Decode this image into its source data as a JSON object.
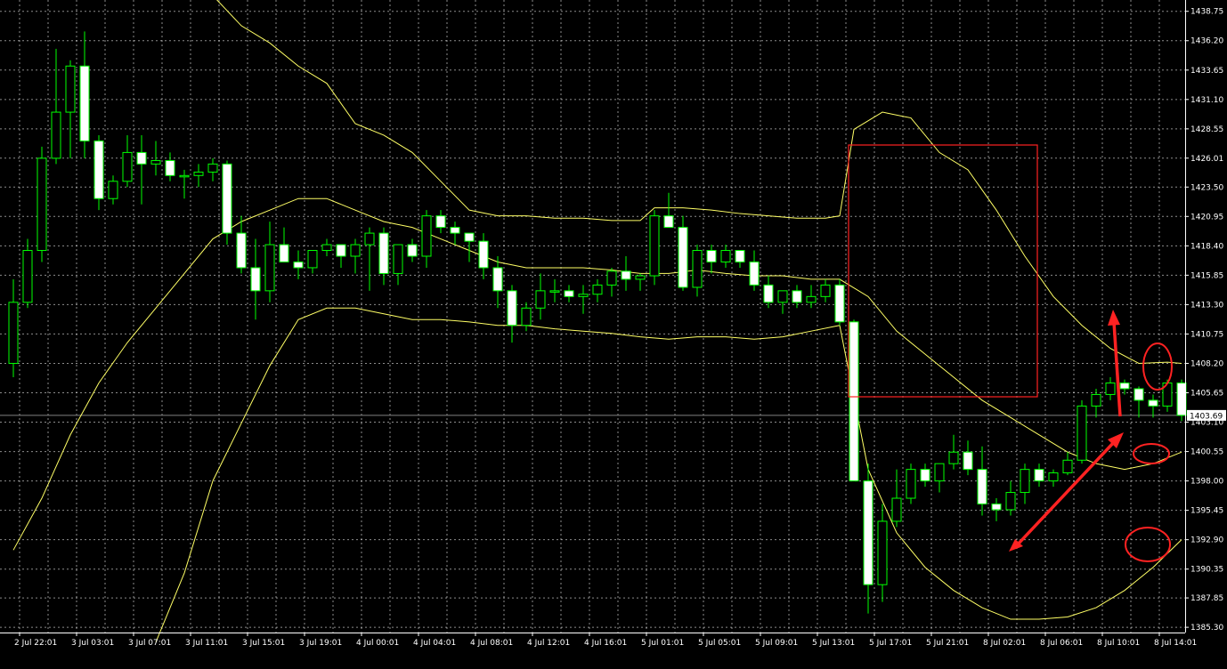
{
  "colors": {
    "background": "#000000",
    "grid": "#ffffff",
    "candle_up": "#000000",
    "candle_down": "#ffffff",
    "wick": "#00ff00",
    "bands": "#ffff66",
    "annotation": "#ff2222",
    "price_line": "#808080",
    "axis_text": "#ffffff"
  },
  "chart_data": {
    "type": "candlestick",
    "title": "",
    "xlabel": "",
    "ylabel": "",
    "ylim": [
      1385.0,
      1439.5
    ],
    "grid": true,
    "y_ticks": [
      "1438.75",
      "1436.20",
      "1433.65",
      "1431.10",
      "1428.55",
      "1426.01",
      "1423.50",
      "1420.95",
      "1418.40",
      "1415.85",
      "1413.30",
      "1410.75",
      "1408.20",
      "1405.65",
      "1403.10",
      "1400.55",
      "1398.00",
      "1395.45",
      "1392.90",
      "1390.35",
      "1387.85",
      "1385.30"
    ],
    "x_labels": [
      "2 Jul 22:01",
      "3 Jul 03:01",
      "3 Jul 07:01",
      "3 Jul 11:01",
      "3 Jul 15:01",
      "3 Jul 19:01",
      "4 Jul 00:01",
      "4 Jul 04:01",
      "4 Jul 08:01",
      "4 Jul 12:01",
      "4 Jul 16:01",
      "5 Jul 01:01",
      "5 Jul 05:01",
      "5 Jul 09:01",
      "5 Jul 13:01",
      "5 Jul 17:01",
      "5 Jul 21:01",
      "8 Jul 02:01",
      "8 Jul 06:01",
      "8 Jul 10:01",
      "8 Jul 14:01"
    ],
    "current_price": "1403.69",
    "candles": [
      {
        "o": 1408.2,
        "h": 1415.5,
        "l": 1407.0,
        "c": 1413.5
      },
      {
        "o": 1413.5,
        "h": 1419.0,
        "l": 1413.0,
        "c": 1418.0
      },
      {
        "o": 1418.0,
        "h": 1427.0,
        "l": 1417.0,
        "c": 1426.0
      },
      {
        "o": 1426.0,
        "h": 1435.5,
        "l": 1425.5,
        "c": 1430.0
      },
      {
        "o": 1430.0,
        "h": 1434.5,
        "l": 1426.0,
        "c": 1434.0
      },
      {
        "o": 1434.0,
        "h": 1437.0,
        "l": 1426.0,
        "c": 1427.5
      },
      {
        "o": 1427.5,
        "h": 1428.0,
        "l": 1421.5,
        "c": 1422.5
      },
      {
        "o": 1422.5,
        "h": 1424.5,
        "l": 1422.0,
        "c": 1424.0
      },
      {
        "o": 1424.0,
        "h": 1428.0,
        "l": 1423.5,
        "c": 1426.5
      },
      {
        "o": 1426.5,
        "h": 1428.0,
        "l": 1422.0,
        "c": 1425.5
      },
      {
        "o": 1425.5,
        "h": 1427.5,
        "l": 1424.5,
        "c": 1425.8
      },
      {
        "o": 1425.8,
        "h": 1426.5,
        "l": 1424.0,
        "c": 1424.5
      },
      {
        "o": 1424.5,
        "h": 1425.0,
        "l": 1422.5,
        "c": 1424.5
      },
      {
        "o": 1424.5,
        "h": 1425.5,
        "l": 1423.5,
        "c": 1424.8
      },
      {
        "o": 1424.8,
        "h": 1426.0,
        "l": 1424.0,
        "c": 1425.5
      },
      {
        "o": 1425.5,
        "h": 1425.8,
        "l": 1418.5,
        "c": 1419.5
      },
      {
        "o": 1419.5,
        "h": 1421.0,
        "l": 1416.0,
        "c": 1416.5
      },
      {
        "o": 1416.5,
        "h": 1419.0,
        "l": 1412.0,
        "c": 1414.5
      },
      {
        "o": 1414.5,
        "h": 1420.5,
        "l": 1413.5,
        "c": 1418.5
      },
      {
        "o": 1418.5,
        "h": 1420.0,
        "l": 1417.0,
        "c": 1417.0
      },
      {
        "o": 1417.0,
        "h": 1418.0,
        "l": 1415.5,
        "c": 1416.5
      },
      {
        "o": 1416.5,
        "h": 1418.0,
        "l": 1416.0,
        "c": 1418.0
      },
      {
        "o": 1418.0,
        "h": 1419.0,
        "l": 1417.5,
        "c": 1418.5
      },
      {
        "o": 1418.5,
        "h": 1418.5,
        "l": 1416.5,
        "c": 1417.5
      },
      {
        "o": 1417.5,
        "h": 1419.0,
        "l": 1416.0,
        "c": 1418.5
      },
      {
        "o": 1418.5,
        "h": 1420.0,
        "l": 1414.5,
        "c": 1419.5
      },
      {
        "o": 1419.5,
        "h": 1420.0,
        "l": 1415.0,
        "c": 1416.0
      },
      {
        "o": 1416.0,
        "h": 1418.5,
        "l": 1415.0,
        "c": 1418.5
      },
      {
        "o": 1418.5,
        "h": 1419.0,
        "l": 1417.0,
        "c": 1417.5
      },
      {
        "o": 1417.5,
        "h": 1421.5,
        "l": 1416.5,
        "c": 1421.0
      },
      {
        "o": 1421.0,
        "h": 1421.5,
        "l": 1419.5,
        "c": 1420.0
      },
      {
        "o": 1420.0,
        "h": 1420.5,
        "l": 1418.5,
        "c": 1419.5
      },
      {
        "o": 1419.5,
        "h": 1419.5,
        "l": 1417.0,
        "c": 1418.8
      },
      {
        "o": 1418.8,
        "h": 1419.5,
        "l": 1415.5,
        "c": 1416.5
      },
      {
        "o": 1416.5,
        "h": 1417.5,
        "l": 1413.0,
        "c": 1414.5
      },
      {
        "o": 1414.5,
        "h": 1415.0,
        "l": 1410.0,
        "c": 1411.5
      },
      {
        "o": 1411.5,
        "h": 1413.5,
        "l": 1411.0,
        "c": 1413.0
      },
      {
        "o": 1413.0,
        "h": 1416.0,
        "l": 1412.0,
        "c": 1414.5
      },
      {
        "o": 1414.5,
        "h": 1415.5,
        "l": 1413.5,
        "c": 1414.5
      },
      {
        "o": 1414.5,
        "h": 1415.0,
        "l": 1413.5,
        "c": 1414.0
      },
      {
        "o": 1414.0,
        "h": 1415.0,
        "l": 1412.5,
        "c": 1414.2
      },
      {
        "o": 1414.2,
        "h": 1415.5,
        "l": 1413.5,
        "c": 1415.0
      },
      {
        "o": 1415.0,
        "h": 1416.5,
        "l": 1414.0,
        "c": 1416.2
      },
      {
        "o": 1416.2,
        "h": 1417.5,
        "l": 1414.5,
        "c": 1415.5
      },
      {
        "o": 1415.5,
        "h": 1416.0,
        "l": 1414.5,
        "c": 1415.8
      },
      {
        "o": 1415.8,
        "h": 1421.5,
        "l": 1415.0,
        "c": 1421.0
      },
      {
        "o": 1421.0,
        "h": 1423.0,
        "l": 1420.0,
        "c": 1420.0
      },
      {
        "o": 1420.0,
        "h": 1421.0,
        "l": 1414.5,
        "c": 1414.8
      },
      {
        "o": 1414.8,
        "h": 1418.5,
        "l": 1414.0,
        "c": 1418.0
      },
      {
        "o": 1418.0,
        "h": 1418.5,
        "l": 1416.0,
        "c": 1417.0
      },
      {
        "o": 1417.0,
        "h": 1418.5,
        "l": 1416.5,
        "c": 1418.0
      },
      {
        "o": 1418.0,
        "h": 1418.0,
        "l": 1416.5,
        "c": 1417.0
      },
      {
        "o": 1417.0,
        "h": 1418.0,
        "l": 1414.5,
        "c": 1415.0
      },
      {
        "o": 1415.0,
        "h": 1415.8,
        "l": 1413.0,
        "c": 1413.5
      },
      {
        "o": 1413.5,
        "h": 1414.5,
        "l": 1412.5,
        "c": 1414.5
      },
      {
        "o": 1414.5,
        "h": 1415.0,
        "l": 1413.0,
        "c": 1413.5
      },
      {
        "o": 1413.5,
        "h": 1415.0,
        "l": 1413.0,
        "c": 1414.0
      },
      {
        "o": 1414.0,
        "h": 1415.5,
        "l": 1413.5,
        "c": 1415.0
      },
      {
        "o": 1415.0,
        "h": 1415.5,
        "l": 1411.5,
        "c": 1411.8
      },
      {
        "o": 1411.8,
        "h": 1412.0,
        "l": 1398.5,
        "c": 1398.0
      },
      {
        "o": 1398.0,
        "h": 1399.5,
        "l": 1386.5,
        "c": 1389.0
      },
      {
        "o": 1389.0,
        "h": 1396.0,
        "l": 1387.5,
        "c": 1394.5
      },
      {
        "o": 1394.5,
        "h": 1399.0,
        "l": 1394.0,
        "c": 1396.5
      },
      {
        "o": 1396.5,
        "h": 1399.5,
        "l": 1396.0,
        "c": 1399.0
      },
      {
        "o": 1399.0,
        "h": 1399.5,
        "l": 1397.5,
        "c": 1398.0
      },
      {
        "o": 1398.0,
        "h": 1399.5,
        "l": 1397.0,
        "c": 1399.5
      },
      {
        "o": 1399.5,
        "h": 1402.0,
        "l": 1399.0,
        "c": 1400.5
      },
      {
        "o": 1400.5,
        "h": 1401.5,
        "l": 1398.5,
        "c": 1399.0
      },
      {
        "o": 1399.0,
        "h": 1401.0,
        "l": 1395.0,
        "c": 1396.0
      },
      {
        "o": 1396.0,
        "h": 1396.5,
        "l": 1394.5,
        "c": 1395.5
      },
      {
        "o": 1395.5,
        "h": 1398.0,
        "l": 1395.0,
        "c": 1397.0
      },
      {
        "o": 1397.0,
        "h": 1399.5,
        "l": 1396.0,
        "c": 1399.0
      },
      {
        "o": 1399.0,
        "h": 1399.5,
        "l": 1397.5,
        "c": 1398.0
      },
      {
        "o": 1398.0,
        "h": 1399.0,
        "l": 1397.5,
        "c": 1398.7
      },
      {
        "o": 1398.7,
        "h": 1400.5,
        "l": 1398.5,
        "c": 1399.8
      },
      {
        "o": 1399.8,
        "h": 1405.0,
        "l": 1399.5,
        "c": 1404.5
      },
      {
        "o": 1404.5,
        "h": 1406.0,
        "l": 1403.5,
        "c": 1405.5
      },
      {
        "o": 1405.5,
        "h": 1407.0,
        "l": 1405.0,
        "c": 1406.5
      },
      {
        "o": 1406.5,
        "h": 1406.8,
        "l": 1405.5,
        "c": 1406.0
      },
      {
        "o": 1406.0,
        "h": 1406.2,
        "l": 1403.5,
        "c": 1405.0
      },
      {
        "o": 1405.0,
        "h": 1405.5,
        "l": 1403.5,
        "c": 1404.5
      },
      {
        "o": 1404.5,
        "h": 1406.8,
        "l": 1404.0,
        "c": 1406.5
      },
      {
        "o": 1406.5,
        "h": 1406.8,
        "l": 1403.2,
        "c": 1403.69
      }
    ],
    "bands": {
      "upper": [
        [
          0,
          1441.5
        ],
        [
          3,
          1441.5
        ],
        [
          6,
          1441.5
        ],
        [
          9,
          1441.5
        ],
        [
          12,
          1441.5
        ],
        [
          14,
          1441.0
        ],
        [
          16,
          1437.5
        ],
        [
          18,
          1436.0
        ],
        [
          20,
          1434.0
        ],
        [
          22,
          1432.5
        ],
        [
          24,
          1429.0
        ],
        [
          26,
          1428.0
        ],
        [
          28,
          1426.5
        ],
        [
          30,
          1424.0
        ],
        [
          32,
          1421.5
        ],
        [
          34,
          1421.0
        ],
        [
          36,
          1421.0
        ],
        [
          38,
          1420.8
        ],
        [
          40,
          1420.8
        ],
        [
          42,
          1420.6
        ],
        [
          44,
          1420.6
        ],
        [
          45,
          1421.7
        ],
        [
          47,
          1421.7
        ],
        [
          49,
          1421.5
        ],
        [
          51,
          1421.2
        ],
        [
          53,
          1421.0
        ],
        [
          55,
          1420.8
        ],
        [
          57,
          1420.8
        ],
        [
          58,
          1421.0
        ],
        [
          59,
          1428.5
        ],
        [
          61,
          1430.0
        ],
        [
          63,
          1429.5
        ],
        [
          65,
          1426.5
        ],
        [
          67,
          1425.0
        ],
        [
          69,
          1421.5
        ],
        [
          71,
          1417.5
        ],
        [
          73,
          1414.0
        ],
        [
          75,
          1411.5
        ],
        [
          77,
          1409.5
        ],
        [
          79,
          1408.2
        ],
        [
          81,
          1408.3
        ],
        [
          82,
          1408.2
        ]
      ],
      "middle": [
        [
          0,
          1392.0
        ],
        [
          2,
          1396.5
        ],
        [
          4,
          1402.0
        ],
        [
          6,
          1406.5
        ],
        [
          8,
          1410.0
        ],
        [
          10,
          1413.0
        ],
        [
          12,
          1416.0
        ],
        [
          14,
          1419.0
        ],
        [
          16,
          1420.5
        ],
        [
          18,
          1421.5
        ],
        [
          20,
          1422.5
        ],
        [
          22,
          1422.5
        ],
        [
          24,
          1421.5
        ],
        [
          26,
          1420.5
        ],
        [
          28,
          1420.0
        ],
        [
          30,
          1419.0
        ],
        [
          32,
          1418.0
        ],
        [
          34,
          1417.0
        ],
        [
          36,
          1416.5
        ],
        [
          38,
          1416.5
        ],
        [
          40,
          1416.5
        ],
        [
          42,
          1416.3
        ],
        [
          44,
          1416.0
        ],
        [
          46,
          1416.0
        ],
        [
          48,
          1416.3
        ],
        [
          50,
          1416.0
        ],
        [
          52,
          1415.8
        ],
        [
          54,
          1415.8
        ],
        [
          56,
          1415.5
        ],
        [
          58,
          1415.5
        ],
        [
          60,
          1414.0
        ],
        [
          62,
          1411.0
        ],
        [
          64,
          1409.0
        ],
        [
          66,
          1407.0
        ],
        [
          68,
          1405.0
        ],
        [
          70,
          1403.5
        ],
        [
          72,
          1402.0
        ],
        [
          74,
          1400.5
        ],
        [
          76,
          1399.5
        ],
        [
          78,
          1399.0
        ],
        [
          80,
          1399.5
        ],
        [
          82,
          1400.5
        ]
      ],
      "lower": [
        [
          10,
          1384.0
        ],
        [
          12,
          1390.0
        ],
        [
          14,
          1398.0
        ],
        [
          16,
          1403.0
        ],
        [
          18,
          1408.0
        ],
        [
          20,
          1412.0
        ],
        [
          22,
          1413.0
        ],
        [
          24,
          1413.0
        ],
        [
          26,
          1412.5
        ],
        [
          28,
          1412.0
        ],
        [
          30,
          1412.0
        ],
        [
          32,
          1411.8
        ],
        [
          34,
          1411.5
        ],
        [
          36,
          1411.5
        ],
        [
          38,
          1411.2
        ],
        [
          40,
          1411.0
        ],
        [
          42,
          1410.8
        ],
        [
          44,
          1410.5
        ],
        [
          46,
          1410.3
        ],
        [
          48,
          1410.5
        ],
        [
          50,
          1410.5
        ],
        [
          52,
          1410.3
        ],
        [
          54,
          1410.5
        ],
        [
          56,
          1411.0
        ],
        [
          58,
          1411.5
        ],
        [
          60,
          1399.0
        ],
        [
          62,
          1393.5
        ],
        [
          64,
          1390.5
        ],
        [
          66,
          1388.5
        ],
        [
          68,
          1387.0
        ],
        [
          70,
          1386.0
        ],
        [
          72,
          1386.0
        ],
        [
          74,
          1386.2
        ],
        [
          76,
          1387.0
        ],
        [
          78,
          1388.5
        ],
        [
          80,
          1390.5
        ],
        [
          82,
          1392.9
        ]
      ]
    }
  }
}
